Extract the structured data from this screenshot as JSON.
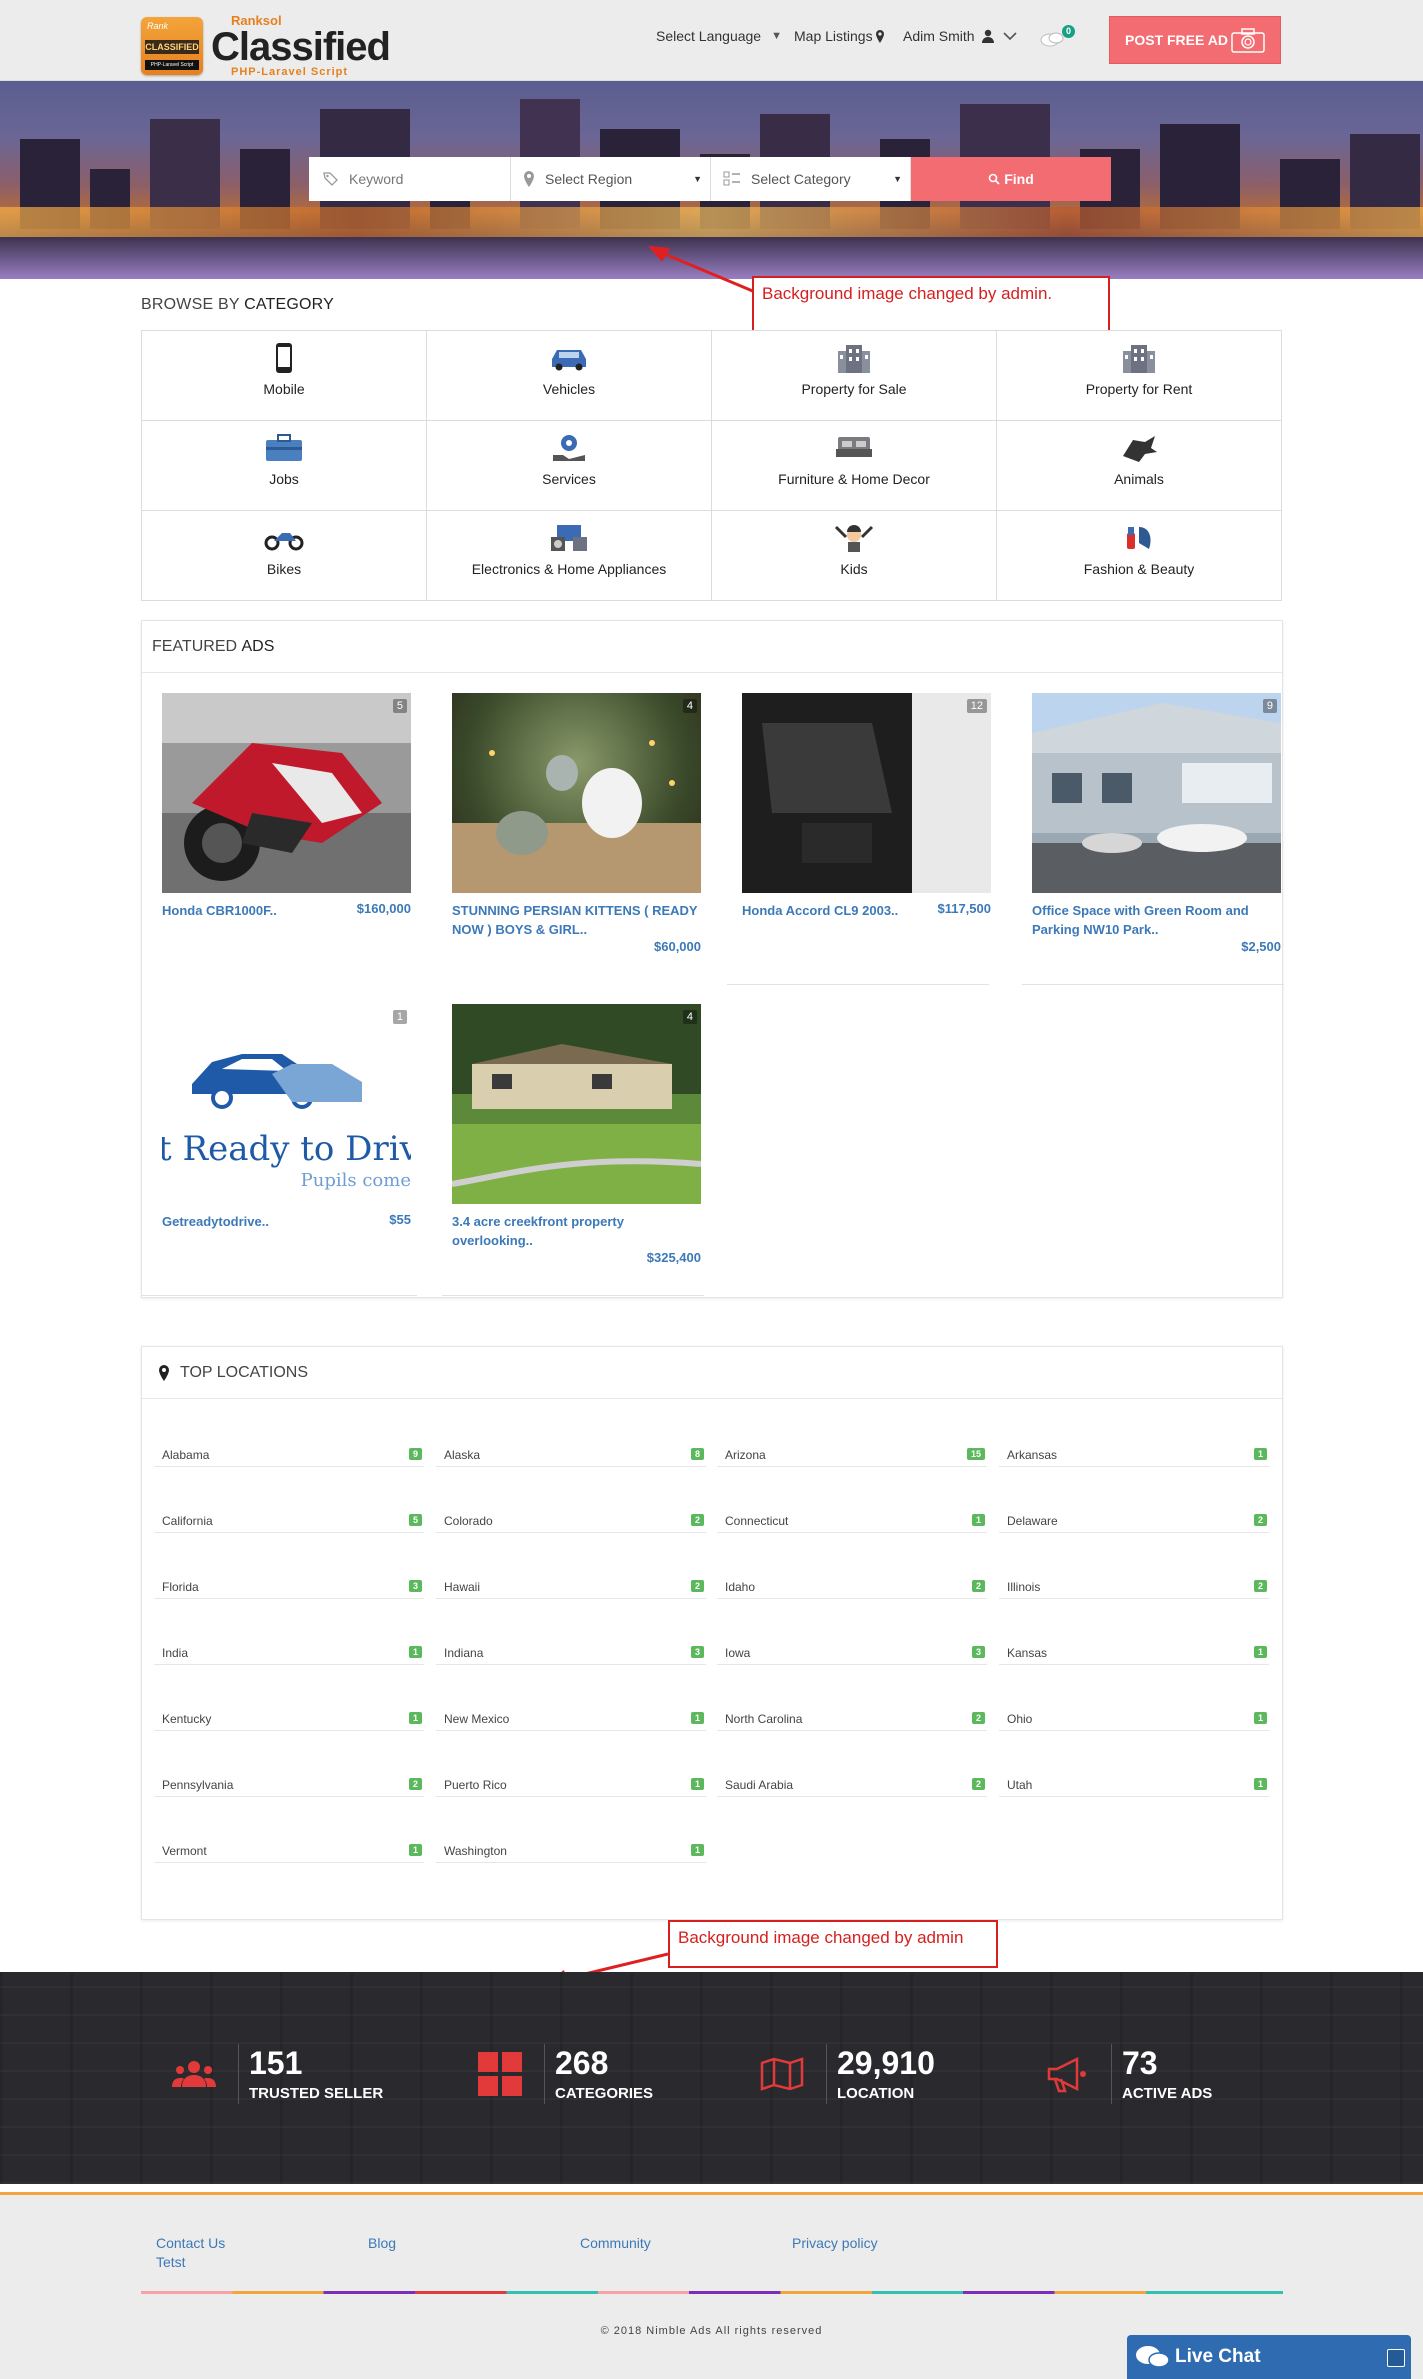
{
  "header": {
    "logo_small": "Ranksol",
    "logo_main": "Classified",
    "logo_sub": "PHP-Laravel Script",
    "badge_top": "Rank",
    "badge_mid": "CLASSIFIED",
    "badge_bot": "PHP-Laravel Script",
    "select_language": "Select Language",
    "map_listings": "Map Listings",
    "user_name": "Adim Smith",
    "chat_count": "0",
    "post_ad": "POST FREE AD"
  },
  "search": {
    "keyword_placeholder": "Keyword",
    "region": "Select Region",
    "category": "Select Category",
    "find": "Find"
  },
  "notes": {
    "hero": "Background image changed by admin.",
    "stats": "Background image changed by admin"
  },
  "browse": {
    "title_prefix": "BROWSE BY",
    "title_bold": "CATEGORY",
    "categories": [
      {
        "label": "Mobile",
        "icon": "mobile-icon"
      },
      {
        "label": "Vehicles",
        "icon": "car-icon"
      },
      {
        "label": "Property for Sale",
        "icon": "building-icon"
      },
      {
        "label": "Property for Rent",
        "icon": "building-icon"
      },
      {
        "label": "Jobs",
        "icon": "briefcase-icon"
      },
      {
        "label": "Services",
        "icon": "services-icon"
      },
      {
        "label": "Furniture & Home Decor",
        "icon": "bed-icon"
      },
      {
        "label": "Animals",
        "icon": "animal-icon"
      },
      {
        "label": "Bikes",
        "icon": "motorbike-icon"
      },
      {
        "label": "Electronics & Home Appliances",
        "icon": "electronics-icon"
      },
      {
        "label": "Kids",
        "icon": "kid-icon"
      },
      {
        "label": "Fashion & Beauty",
        "icon": "fashion-icon"
      }
    ]
  },
  "featured": {
    "title_prefix": "FEATURED",
    "title_bold": "ADS",
    "ads": [
      {
        "title": "Honda CBR1000F..",
        "price": "$160,000",
        "count": "5"
      },
      {
        "title": "STUNNING PERSIAN KITTENS ( READY NOW ) BOYS & GIRL..",
        "price": "$60,000",
        "count": "4"
      },
      {
        "title": "Honda Accord CL9 2003..",
        "price": "$117,500",
        "count": "12"
      },
      {
        "title": "Office Space with Green Room and Parking NW10 Park..",
        "price": "$2,500",
        "count": "9"
      },
      {
        "title": "Getreadytodrive..",
        "price": "$55",
        "count": "1",
        "image_text_1": "t Ready to Driv",
        "image_text_2": "Pupils come"
      },
      {
        "title": "3.4 acre creekfront property overlooking..",
        "price": "$325,400",
        "count": "4"
      }
    ]
  },
  "locations": {
    "title": "TOP LOCATIONS",
    "items": [
      {
        "name": "Alabama",
        "count": "9"
      },
      {
        "name": "Alaska",
        "count": "8"
      },
      {
        "name": "Arizona",
        "count": "15"
      },
      {
        "name": "Arkansas",
        "count": "1"
      },
      {
        "name": "California",
        "count": "5"
      },
      {
        "name": "Colorado",
        "count": "2"
      },
      {
        "name": "Connecticut",
        "count": "1"
      },
      {
        "name": "Delaware",
        "count": "2"
      },
      {
        "name": "Florida",
        "count": "3"
      },
      {
        "name": "Hawaii",
        "count": "2"
      },
      {
        "name": "Idaho",
        "count": "2"
      },
      {
        "name": "Illinois",
        "count": "2"
      },
      {
        "name": "India",
        "count": "1"
      },
      {
        "name": "Indiana",
        "count": "3"
      },
      {
        "name": "Iowa",
        "count": "3"
      },
      {
        "name": "Kansas",
        "count": "1"
      },
      {
        "name": "Kentucky",
        "count": "1"
      },
      {
        "name": "New Mexico",
        "count": "1"
      },
      {
        "name": "North Carolina",
        "count": "2"
      },
      {
        "name": "Ohio",
        "count": "1"
      },
      {
        "name": "Pennsylvania",
        "count": "2"
      },
      {
        "name": "Puerto Rico",
        "count": "1"
      },
      {
        "name": "Saudi Arabia",
        "count": "2"
      },
      {
        "name": "Utah",
        "count": "1"
      },
      {
        "name": "Vermont",
        "count": "1"
      },
      {
        "name": "Washington",
        "count": "1"
      }
    ]
  },
  "stats": [
    {
      "value": "151",
      "label": "TRUSTED SELLER",
      "icon": "users-icon"
    },
    {
      "value": "268",
      "label": "CATEGORIES",
      "icon": "grid-icon"
    },
    {
      "value": "29,910",
      "label": "LOCATION",
      "icon": "map-icon"
    },
    {
      "value": "73",
      "label": "ACTIVE ADS",
      "icon": "megaphone-icon"
    }
  ],
  "footer": {
    "contact": "Contact Us",
    "tetst": "Tetst",
    "blog": "Blog",
    "community": "Community",
    "privacy": "Privacy policy",
    "copyright": "© 2018 Nimble Ads All rights reserved",
    "live_chat": "Live Chat"
  },
  "colors": {
    "accent": "#f36c72",
    "link": "#3c79b8",
    "badge": "#5cb85c",
    "stats_bg": "#2a2a2e"
  }
}
